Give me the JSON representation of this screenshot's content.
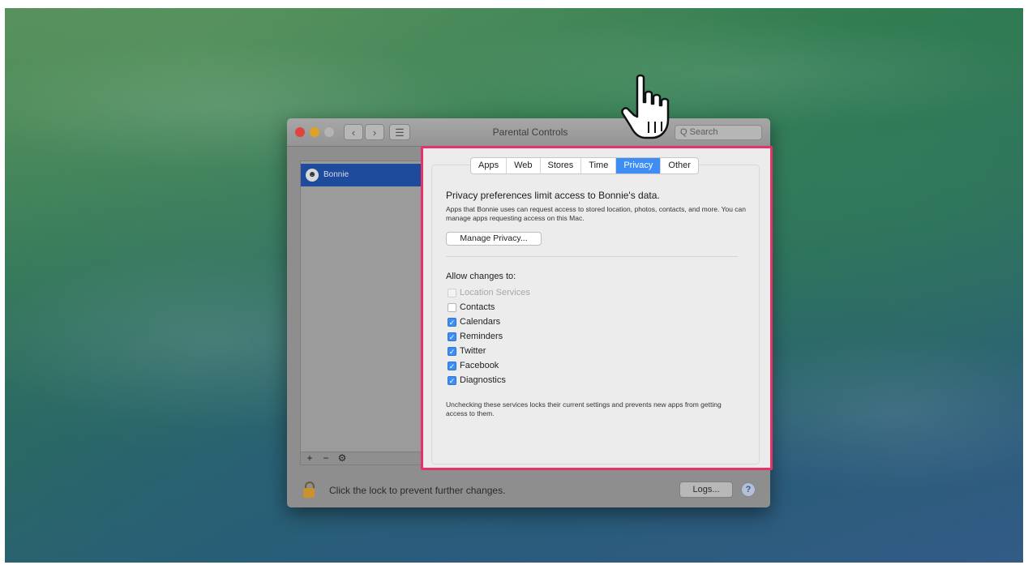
{
  "window": {
    "title": "Parental Controls",
    "search_placeholder": "Q Search"
  },
  "sidebar": {
    "users": [
      {
        "name": "Bonnie",
        "selected": true
      }
    ],
    "tools": {
      "add": "+",
      "remove": "−",
      "gear": "⚙"
    }
  },
  "tabs": [
    {
      "label": "Apps",
      "active": false
    },
    {
      "label": "Web",
      "active": false
    },
    {
      "label": "Stores",
      "active": false
    },
    {
      "label": "Time",
      "active": false
    },
    {
      "label": "Privacy",
      "active": true
    },
    {
      "label": "Other",
      "active": false
    }
  ],
  "privacy": {
    "headline": "Privacy preferences limit access to Bonnie's data.",
    "description": "Apps that Bonnie uses can request access to stored location, photos, contacts, and more. You can manage apps requesting access on this Mac.",
    "manage_button": "Manage Privacy...",
    "allow_label": "Allow changes to:",
    "options": [
      {
        "label": "Location Services",
        "checked": false,
        "disabled": true
      },
      {
        "label": "Contacts",
        "checked": false,
        "disabled": false
      },
      {
        "label": "Calendars",
        "checked": true,
        "disabled": false
      },
      {
        "label": "Reminders",
        "checked": true,
        "disabled": false
      },
      {
        "label": "Twitter",
        "checked": true,
        "disabled": false
      },
      {
        "label": "Facebook",
        "checked": true,
        "disabled": false
      },
      {
        "label": "Diagnostics",
        "checked": true,
        "disabled": false
      }
    ],
    "footnote": "Unchecking these services locks their current settings and prevents new apps from getting access to them."
  },
  "footer": {
    "lock_text": "Click the lock to prevent further changes.",
    "logs_button": "Logs...",
    "help": "?"
  },
  "colors": {
    "highlight_border": "#e5336a",
    "accent": "#3d8df5",
    "selection": "#1f4b9c"
  },
  "icons": [
    "pointing-hand-cursor-icon",
    "lock-icon",
    "gear-icon",
    "help-icon",
    "user-avatar-icon"
  ]
}
